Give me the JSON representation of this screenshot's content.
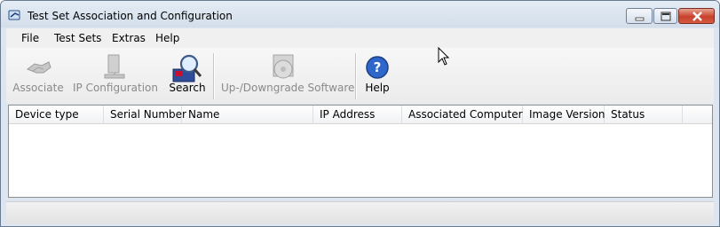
{
  "window": {
    "title": "Test Set Association and Configuration"
  },
  "menu": [
    "File",
    "Test Sets",
    "Extras",
    "Help"
  ],
  "toolbar": {
    "associate": "Associate",
    "ip_configuration": "IP Configuration",
    "search": "Search",
    "updowngrade": "Up-/Downgrade Software",
    "help": "Help"
  },
  "table": {
    "columns": [
      "Device type",
      "Serial Number",
      "Name",
      "IP Address",
      "Associated Computer",
      "Image Version",
      "Status"
    ]
  }
}
